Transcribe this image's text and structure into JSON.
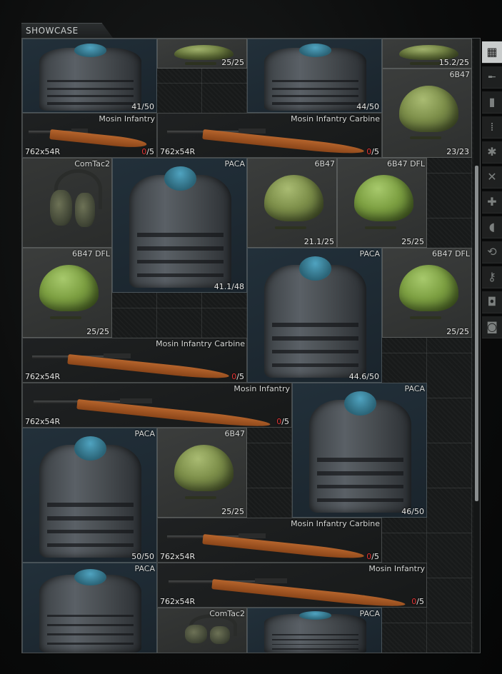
{
  "header": {
    "title": "SHOWCASE"
  },
  "items": [
    {
      "id": "a1",
      "kind": "armor",
      "name": "",
      "durability": "41/50"
    },
    {
      "id": "a2",
      "kind": "helm",
      "name": "",
      "durability": "25/25"
    },
    {
      "id": "a3",
      "kind": "armor",
      "name": "",
      "durability": "44/50"
    },
    {
      "id": "a4",
      "kind": "helm",
      "name": "",
      "durability": "15.2/25"
    },
    {
      "id": "h1",
      "kind": "helm",
      "name": "6B47",
      "durability": "23/23"
    },
    {
      "id": "r1",
      "kind": "rifle",
      "name": "Mosin Infantry",
      "caliber": "762x54R",
      "ammo_cur": "0",
      "ammo_max": "/5"
    },
    {
      "id": "r2",
      "kind": "rifle",
      "name": "Mosin Infantry Carbine",
      "caliber": "762x54R",
      "ammo_cur": "0",
      "ammo_max": "/5"
    },
    {
      "id": "c1",
      "kind": "headset",
      "name": "ComTac2",
      "durability": ""
    },
    {
      "id": "v1",
      "kind": "armor",
      "name": "PACA",
      "durability": "41.1/48"
    },
    {
      "id": "h2",
      "kind": "helm",
      "name": "6B47",
      "durability": "21.1/25"
    },
    {
      "id": "h3",
      "kind": "helm-dfl",
      "name": "6B47 DFL",
      "durability": "25/25"
    },
    {
      "id": "h4",
      "kind": "helm-dfl",
      "name": "6B47 DFL",
      "durability": "25/25"
    },
    {
      "id": "v2",
      "kind": "armor",
      "name": "PACA",
      "durability": "44.6/50"
    },
    {
      "id": "h5",
      "kind": "helm-dfl",
      "name": "6B47 DFL",
      "durability": "25/25"
    },
    {
      "id": "r3",
      "kind": "rifle",
      "name": "Mosin Infantry Carbine",
      "caliber": "762x54R",
      "ammo_cur": "0",
      "ammo_max": "/5"
    },
    {
      "id": "r4",
      "kind": "rifle",
      "name": "Mosin Infantry",
      "caliber": "762x54R",
      "ammo_cur": "0",
      "ammo_max": "/5"
    },
    {
      "id": "v3",
      "kind": "armor",
      "name": "PACA",
      "durability": "46/50"
    },
    {
      "id": "v4",
      "kind": "armor",
      "name": "PACA",
      "durability": "50/50"
    },
    {
      "id": "h6",
      "kind": "helm",
      "name": "6B47",
      "durability": "25/25"
    },
    {
      "id": "r5",
      "kind": "rifle",
      "name": "Mosin Infantry Carbine",
      "caliber": "762x54R",
      "ammo_cur": "0",
      "ammo_max": "/5"
    },
    {
      "id": "v5",
      "kind": "armor",
      "name": "PACA",
      "durability": ""
    },
    {
      "id": "r6",
      "kind": "rifle",
      "name": "Mosin Infantry",
      "caliber": "762x54R",
      "ammo_cur": "0",
      "ammo_max": "/5"
    },
    {
      "id": "c2",
      "kind": "headset",
      "name": "ComTac2",
      "durability": ""
    },
    {
      "id": "v6",
      "kind": "armor",
      "name": "PACA",
      "durability": ""
    }
  ],
  "sidebar": {
    "tabs": [
      {
        "icon": "grid-icon"
      },
      {
        "icon": "rifle-icon"
      },
      {
        "icon": "magazine-icon"
      },
      {
        "icon": "ammo-icon"
      },
      {
        "icon": "gear-icon"
      },
      {
        "icon": "tools-icon"
      },
      {
        "icon": "medical-icon"
      },
      {
        "icon": "food-icon"
      },
      {
        "icon": "barter-icon"
      },
      {
        "icon": "key-icon"
      },
      {
        "icon": "backpack-icon"
      },
      {
        "icon": "armor-tab-icon"
      }
    ]
  }
}
